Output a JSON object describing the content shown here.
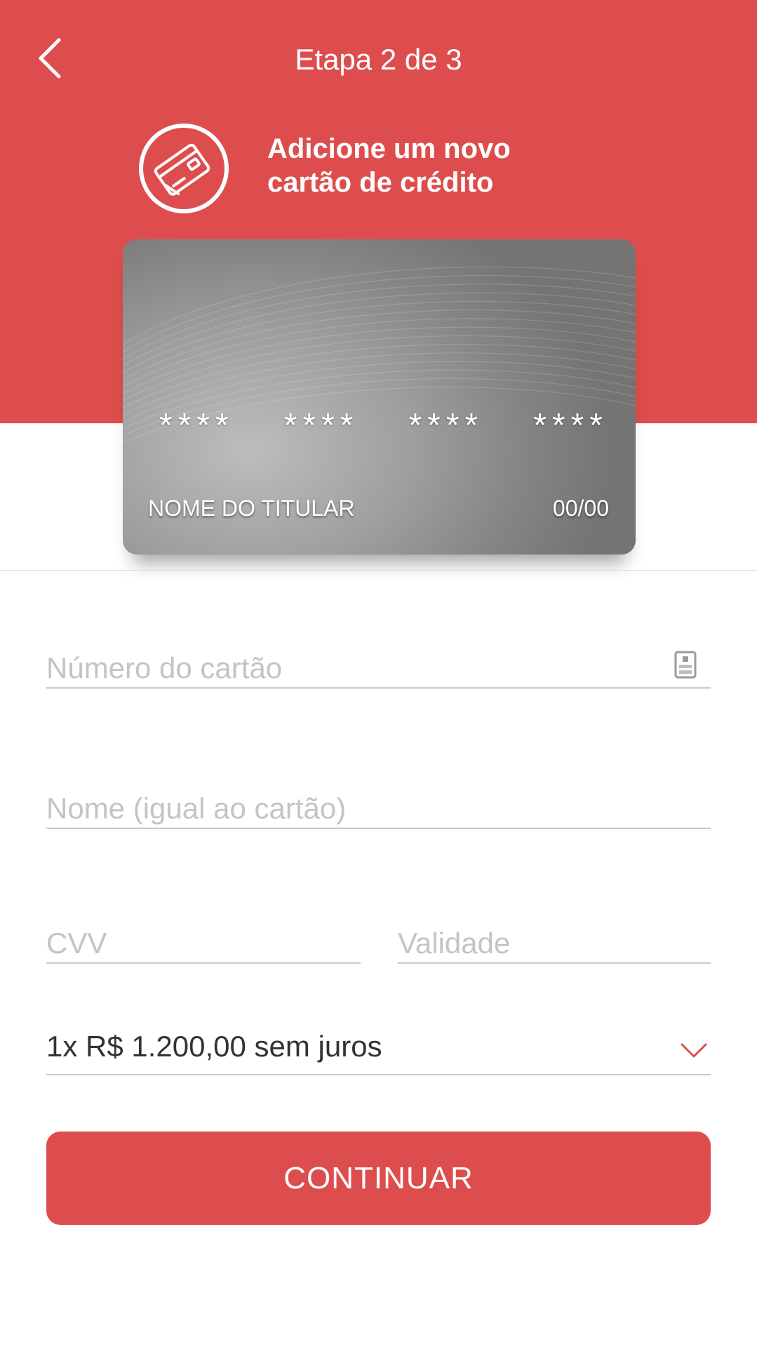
{
  "header": {
    "step_title": "Etapa 2 de 3",
    "headline_line1": "Adicione um novo",
    "headline_line2": "cartão de crédito"
  },
  "card_preview": {
    "number_groups": [
      "****",
      "****",
      "****",
      "****"
    ],
    "holder_name": "NOME DO TITULAR",
    "expiry": "00/00"
  },
  "form": {
    "card_number_placeholder": "Número do cartão",
    "name_placeholder": "Nome (igual ao cartão)",
    "cvv_placeholder": "CVV",
    "expiry_placeholder": "Validade",
    "installments_value": "1x R$ 1.200,00 sem juros"
  },
  "actions": {
    "continue_label": "CONTINUAR"
  },
  "colors": {
    "brand": "#de4d4d",
    "card_gray": "#9e9e9e",
    "placeholder": "#c4c4c4"
  },
  "icons": {
    "back": "chevron-left-icon",
    "card": "credit-card-icon",
    "scan": "card-scan-icon",
    "dropdown": "chevron-down-icon"
  }
}
